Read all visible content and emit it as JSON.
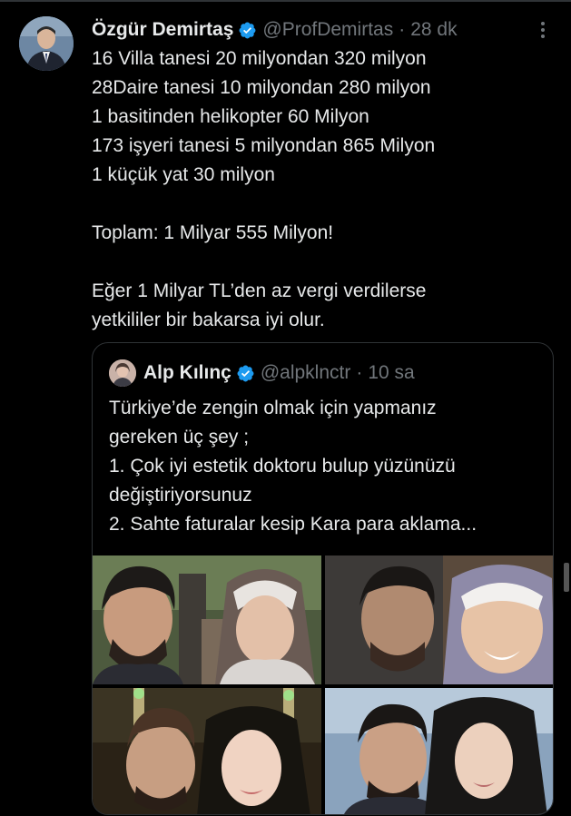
{
  "tweet": {
    "author_name": "Özgür Demirtaş",
    "handle": "@ProfDemirtas",
    "separator": "·",
    "time": "28 dk",
    "lines": [
      "16 Villa tanesi 20 milyondan 320 milyon",
      "28Daire tanesi 10 milyondan 280 milyon",
      "1 basitinden helikopter 60 Milyon",
      "173 işyeri tanesi 5 milyondan 865 Milyon",
      "1 küçük yat 30 milyon",
      "",
      "Toplam: 1 Milyar 555 Milyon!",
      "",
      "Eğer 1 Milyar TL’den az vergi verdilerse",
      "yetkililer bir bakarsa iyi olur."
    ]
  },
  "quote": {
    "author_name": "Alp Kılınç",
    "handle": "@alpklnctr",
    "separator": "·",
    "time": "10 sa",
    "lines": [
      "Türkiye’de zengin olmak için yapmanız",
      "gereken üç şey ;",
      "1. Çok iyi estetik doktoru bulup yüzünüzü",
      "değiştiriyorsunuz",
      "2. Sahte faturalar kesip Kara para aklama..."
    ],
    "media_count": 4
  },
  "colors": {
    "background": "#000000",
    "text": "#e7e9ea",
    "secondary": "#71767b",
    "border": "#2f3336",
    "verified": "#1d9bf0"
  },
  "icons": [
    "verified-badge-icon",
    "more-options-icon"
  ]
}
